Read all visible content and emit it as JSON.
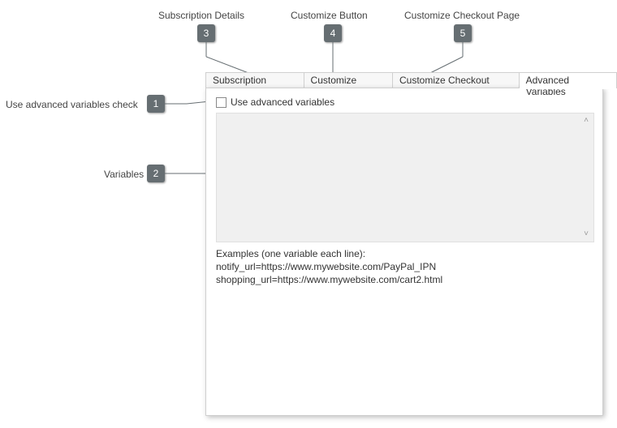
{
  "callouts": {
    "c1": {
      "num": "1",
      "label": "Use advanced variables check"
    },
    "c2": {
      "num": "2",
      "label": "Variables"
    },
    "c3": {
      "num": "3",
      "label": "Subscription Details"
    },
    "c4": {
      "num": "4",
      "label": "Customize Button"
    },
    "c5": {
      "num": "5",
      "label": "Customize Checkout Page"
    }
  },
  "tabs": {
    "t1": "Subscription Details",
    "t2": "Customize Button",
    "t3": "Customize Checkout Page",
    "t4": "Advanced Variables"
  },
  "panel": {
    "checkbox_label": "Use advanced variables",
    "examples_heading": "Examples (one variable each line):",
    "examples_line1": "notify_url=https://www.mywebsite.com/PayPal_IPN",
    "examples_line2": "shopping_url=https://www.mywebsite.com/cart2.html",
    "scroll_up": "˄",
    "scroll_down": "˅"
  }
}
